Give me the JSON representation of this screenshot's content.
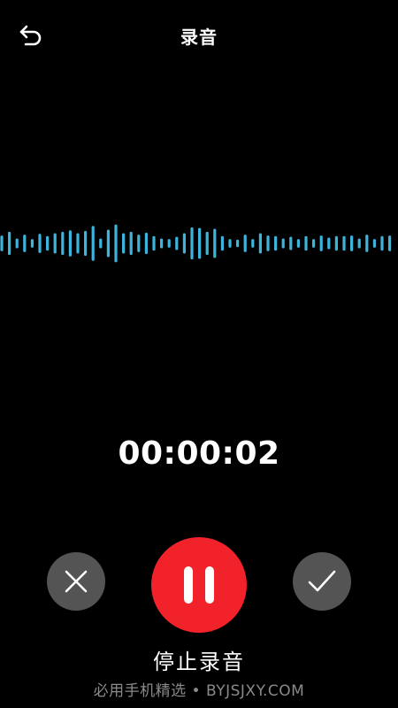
{
  "header": {
    "title": "录音",
    "back_icon": "back-arrow-icon"
  },
  "waveform": {
    "color": "#3cb4dc",
    "levels": [
      0.22,
      0.35,
      0.12,
      0.25,
      0.1,
      0.28,
      0.2,
      0.3,
      0.35,
      0.4,
      0.3,
      0.38,
      0.55,
      0.12,
      0.42,
      0.6,
      0.3,
      0.35,
      0.25,
      0.32,
      0.2,
      0.12,
      0.1,
      0.18,
      0.3,
      0.5,
      0.48,
      0.35,
      0.45,
      0.2,
      0.1,
      0.08,
      0.25,
      0.1,
      0.3,
      0.22,
      0.2,
      0.12,
      0.18,
      0.1,
      0.2,
      0.1,
      0.22,
      0.15,
      0.2,
      0.2,
      0.22,
      0.12,
      0.25,
      0.1,
      0.2,
      0.22,
      0.25
    ]
  },
  "timer": {
    "elapsed": "00:00:02"
  },
  "controls": {
    "cancel_icon": "close-icon",
    "pause_icon": "pause-icon",
    "confirm_icon": "checkmark-icon",
    "cancel_color": "#545454",
    "pause_color": "#f2222a",
    "confirm_color": "#545454",
    "stop_label": "停止录音"
  },
  "watermark": {
    "text": "必用手机精选 • BYJSJXY.COM"
  }
}
